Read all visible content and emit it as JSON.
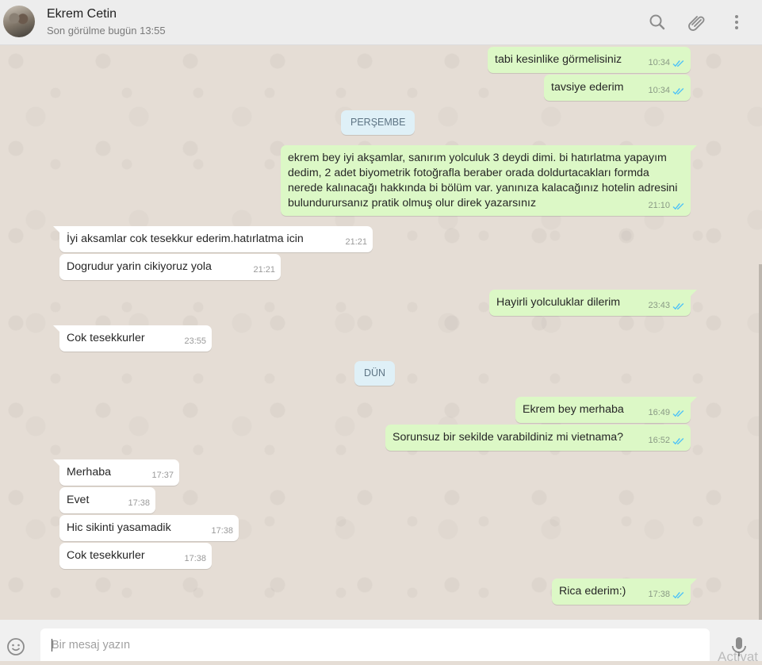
{
  "header": {
    "contact_name": "Ekrem Cetin",
    "status": "Son görülme bugün 13:55",
    "icons": [
      "search-icon",
      "attach-icon",
      "menu-icon"
    ]
  },
  "colors": {
    "outgoing_bubble": "#dcf8c6",
    "incoming_bubble": "#ffffff",
    "read_tick": "#4fc3f7",
    "day_badge": "#dff0f7",
    "chat_background": "#e5ddd5"
  },
  "days": [
    {
      "label": "PERŞEMBE"
    },
    {
      "label": "DÜN"
    }
  ],
  "messages": [
    {
      "dir": "out",
      "text": "tabi kesinlike görmelisiniz",
      "time": "10:34",
      "read": true
    },
    {
      "dir": "out",
      "text": "tavsiye ederim",
      "time": "10:34",
      "read": true
    },
    {
      "dir": "out",
      "text": "ekrem bey iyi akşamlar, sanırım yolculuk 3 deydi dimi. bi hatırlatma yapayım dedim, 2 adet biyometrik fotoğrafla beraber orada doldurtacakları formda nerede kalınacağı hakkında bi bölüm var. yanınıza kalacağınız hotelin adresini bulundurursanız pratik olmuş olur direk yazarsınız",
      "time": "21:10",
      "read": true
    },
    {
      "dir": "in",
      "text": "İyi aksamlar cok tesekkur ederim.hatırlatma icin",
      "time": "21:21"
    },
    {
      "dir": "in",
      "text": "Dogrudur yarin cikiyoruz yola",
      "time": "21:21"
    },
    {
      "dir": "out",
      "text": "Hayirli yolculuklar dilerim",
      "time": "23:43",
      "read": true
    },
    {
      "dir": "in",
      "text": "Cok tesekkurler",
      "time": "23:55"
    },
    {
      "dir": "out",
      "text": "Ekrem bey merhaba",
      "time": "16:49",
      "read": true
    },
    {
      "dir": "out",
      "text": "Sorunsuz bir sekilde varabildiniz mi vietnama?",
      "time": "16:52",
      "read": true
    },
    {
      "dir": "in",
      "text": "Merhaba",
      "time": "17:37"
    },
    {
      "dir": "in",
      "text": "Evet",
      "time": "17:38"
    },
    {
      "dir": "in",
      "text": "Hic sikinti yasamadik",
      "time": "17:38"
    },
    {
      "dir": "in",
      "text": "Cok tesekkurler",
      "time": "17:38"
    },
    {
      "dir": "out",
      "text": "Rica ederim:)",
      "time": "17:38",
      "read": true
    }
  ],
  "composer": {
    "placeholder": "Bir mesaj yazın",
    "value": "",
    "icons": [
      "emoji-icon",
      "microphone-icon"
    ]
  },
  "watermark": "Activat"
}
